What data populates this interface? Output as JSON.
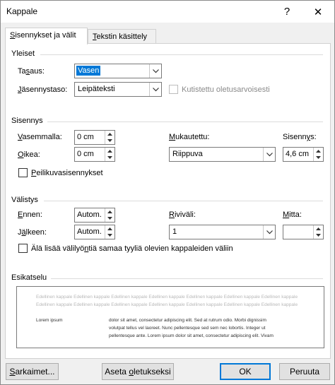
{
  "window": {
    "title": "Kappale",
    "help_label": "?",
    "close_label": "✕"
  },
  "tabs": [
    {
      "label": "Sisennykset ja välit",
      "mnemonic_prefix": "",
      "mnemonic": "S",
      "rest": "isennykset ja välit"
    },
    {
      "label": "Tekstin käsittely",
      "mnemonic_prefix": "",
      "mnemonic": "T",
      "rest": "ekstin käsittely"
    }
  ],
  "general": {
    "title": "Yleiset",
    "alignment": {
      "label_pre": "Ta",
      "label_mn": "s",
      "label_post": "aus:",
      "value": "Vasen"
    },
    "outline_level": {
      "label_pre": "",
      "label_mn": "J",
      "label_post": "äsennystaso:",
      "value": "Leipäteksti"
    },
    "collapsed_default": {
      "label": "Kutistettu oletusarvoisesti",
      "checked": false,
      "enabled": false
    }
  },
  "indentation": {
    "title": "Sisennys",
    "left": {
      "label_pre": "",
      "label_mn": "V",
      "label_post": "asemmalla:",
      "value": "0 cm"
    },
    "right": {
      "label_pre": "",
      "label_mn": "O",
      "label_post": "ikea:",
      "value": "0 cm"
    },
    "special": {
      "label_pre": "",
      "label_mn": "M",
      "label_post": "ukautettu:",
      "value": "Riippuva"
    },
    "by": {
      "label_pre": "Sisenn",
      "label_mn": "y",
      "label_post": "s:",
      "value": "4,6 cm"
    },
    "mirror": {
      "label_pre": "",
      "label_mn": "P",
      "label_post": "eilikuvasisennykset",
      "checked": false
    }
  },
  "spacing": {
    "title": "Välistys",
    "before": {
      "label_pre": "",
      "label_mn": "E",
      "label_post": "nnen:",
      "value": "Autom."
    },
    "after": {
      "label_pre": "J",
      "label_mn": "ä",
      "label_post": "lkeen:",
      "value": "Autom."
    },
    "line_spacing": {
      "label_pre": "",
      "label_mn": "R",
      "label_post": "iviväli:",
      "value": "1"
    },
    "at": {
      "label_pre": "",
      "label_mn": "M",
      "label_post": "itta:",
      "value": ""
    },
    "dont_add": {
      "label_pre": "Älä lisää välilyö",
      "label_mn": "n",
      "label_post": "tiä samaa tyyliä olevien kappaleiden väliin",
      "checked": false
    }
  },
  "preview": {
    "title": "Esikatselu",
    "prev_line1": "Edellinen kappale Edellinen kappale Edellinen kappale Edellinen kappale Edellinen kappale Edellinen kappale Edellinen kappale",
    "prev_line2": "Edellinen kappale Edellinen kappale Edellinen kappale Edellinen kappale Edellinen kappale Edellinen kappale Edellinen kappale",
    "lorem_label": "Lorem ipsum",
    "body_line1": "dolor sit amet, consectetur adipiscing elit. Sed at rutrum odio. Morbi dignissim",
    "body_line2": "volutpat tellus vel laoreet. Nunc pellentesque sed sem nec lobortis. Integer ut",
    "body_line3": "pellentesque ante. Lorem ipsum dolor sit amet, consectetur adipiscing elit. Vivam"
  },
  "buttons": {
    "tabs": {
      "pre": "",
      "mn": "S",
      "post": "arkaimet..."
    },
    "set_default": {
      "pre": "Aseta ",
      "mn": "o",
      "post": "letukseksi"
    },
    "ok": "OK",
    "cancel": "Peruuta"
  },
  "colors": {
    "accent": "#0078d7",
    "panel": "#ffffff",
    "chrome": "#f0f0f0"
  }
}
